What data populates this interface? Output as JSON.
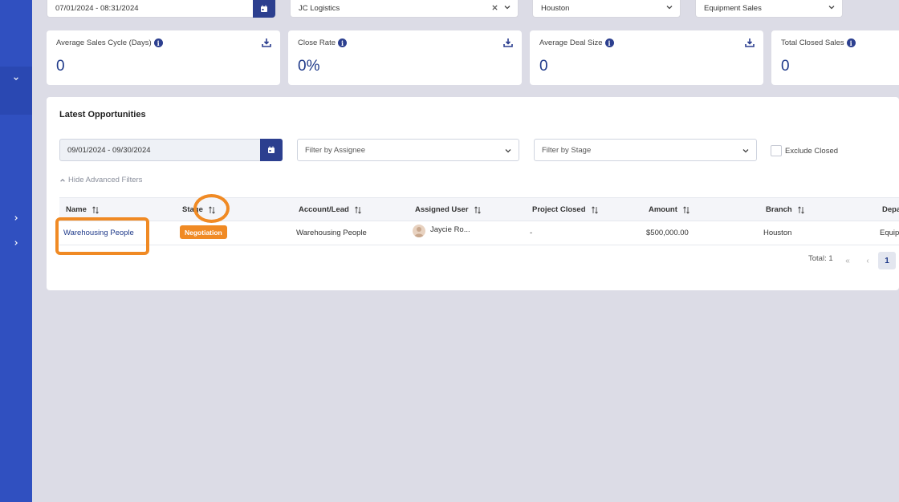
{
  "top_filters": {
    "date_range": "07/01/2024 - 08:31/2024",
    "customer": "JC Logistics",
    "branch": "Houston",
    "department": "Equipment Sales"
  },
  "cards": [
    {
      "title": "Average Sales Cycle (Days)",
      "value": "0"
    },
    {
      "title": "Close Rate",
      "value": "0%"
    },
    {
      "title": "Average Deal Size",
      "value": "0"
    },
    {
      "title": "Total Closed Sales",
      "value": "0"
    }
  ],
  "panel": {
    "title": "Latest Opportunities",
    "date_range": "09/01/2024 - 09/30/2024",
    "assignee_placeholder": "Filter by Assignee",
    "stage_placeholder": "Filter by Stage",
    "exclude_closed_label": "Exclude Closed",
    "advanced_filters_label": "Hide Advanced Filters"
  },
  "table": {
    "headers": [
      "Name",
      "Stage",
      "Account/Lead",
      "Assigned User",
      "Project Closed",
      "Amount",
      "Branch",
      "Depa"
    ],
    "row": {
      "name": "Warehousing People",
      "stage": "Negotiation",
      "account": "Warehousing People",
      "assigned_user": "Jaycie Ro...",
      "project_closed": "-",
      "amount": "$500,000.00",
      "branch": "Houston",
      "department": "Equip"
    }
  },
  "pagination": {
    "total_label": "Total: 1",
    "first": "«",
    "prev": "‹",
    "current_page": "1"
  },
  "colors": {
    "sidebar": "#3050c0",
    "primary": "#2c3f8f",
    "accent_orange": "#f08a24",
    "value_blue": "#1f3a8a"
  }
}
